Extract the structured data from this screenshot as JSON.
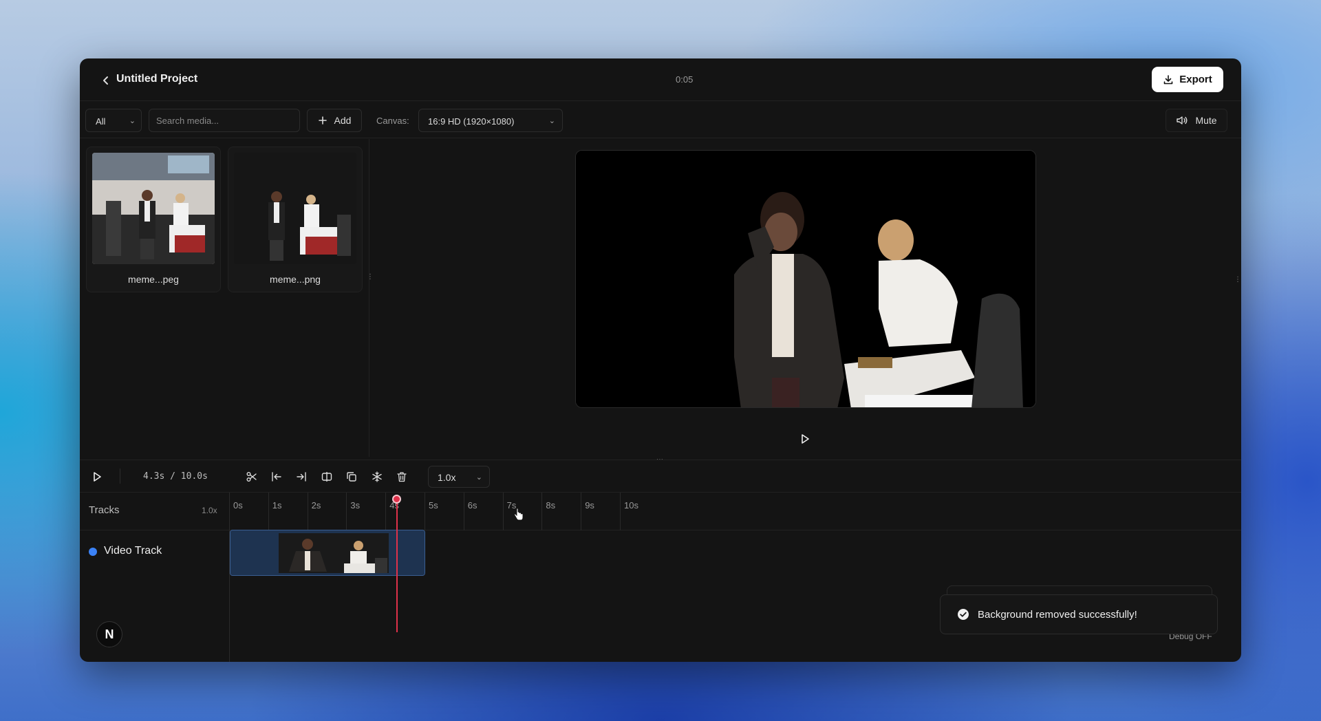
{
  "header": {
    "back_icon": "chevron-left-icon",
    "title": "Untitled Project",
    "duration": "0:05",
    "export_label": "Export",
    "export_icon": "download-icon"
  },
  "toolbar": {
    "filter_value": "All",
    "search_placeholder": "Search media...",
    "add_label": "Add",
    "canvas_label": "Canvas:",
    "canvas_value": "16:9 HD (1920×1080)",
    "mute_label": "Mute",
    "mute_icon": "speaker-icon"
  },
  "media": {
    "items": [
      {
        "name": "meme...peg"
      },
      {
        "name": "meme...png"
      }
    ]
  },
  "timeline": {
    "time_readout": "4.3s / 10.0s",
    "speed_value": "1.0x",
    "tools": [
      "scissors-icon",
      "trim-start-icon",
      "trim-end-icon",
      "split-icon",
      "duplicate-icon",
      "freeze-icon",
      "trash-icon"
    ],
    "tracks_label": "Tracks",
    "tracks_zoom": "1.0x",
    "ticks": [
      "0s",
      "1s",
      "2s",
      "3s",
      "4s",
      "5s",
      "6s",
      "7s",
      "8s",
      "9s",
      "10s"
    ],
    "playhead_seconds": 4.3,
    "track_name": "Video Track",
    "track_color": "#3b82f6",
    "clip_start": 0,
    "clip_end": 5
  },
  "user": {
    "avatar_letter": "N"
  },
  "toast": {
    "message": "Background removed successfully!"
  },
  "debug": {
    "label": "Debug OFF"
  },
  "colors": {
    "accent": "#3b82f6",
    "playhead": "#e0314a"
  }
}
